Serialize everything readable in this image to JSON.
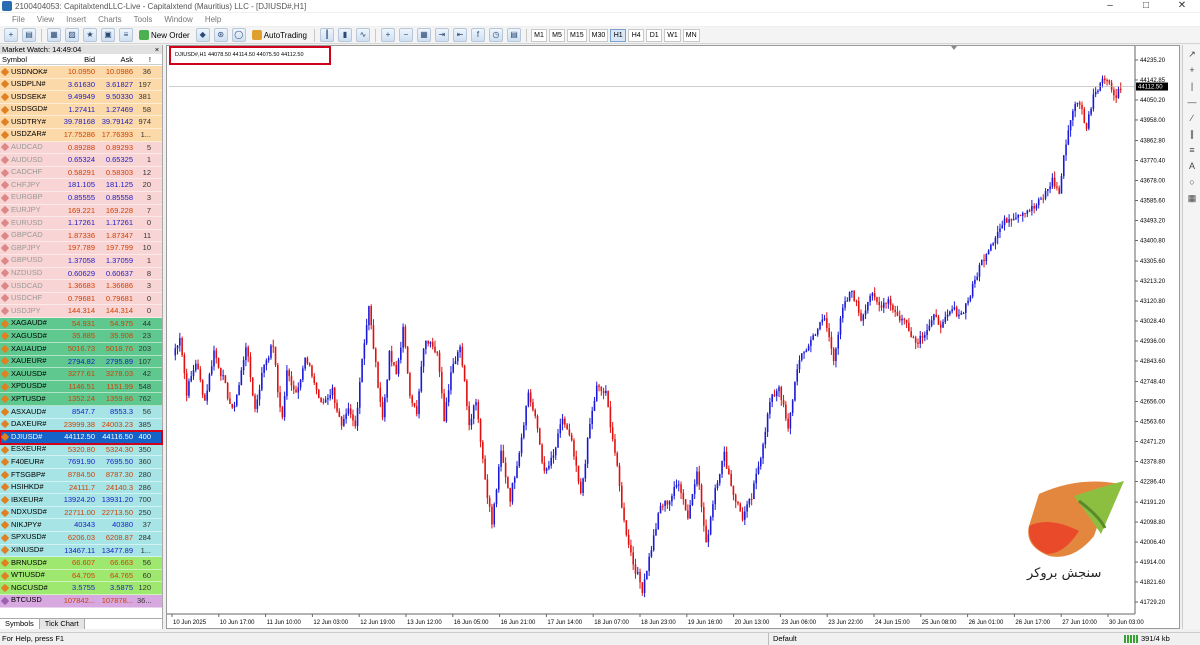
{
  "window": {
    "title": "2100404053: CapitalxtendLLC-Live - Capitalxtend (Mauritius) LLC - [DJIUSD#,H1]"
  },
  "menu": [
    "File",
    "View",
    "Insert",
    "Charts",
    "Tools",
    "Window",
    "Help"
  ],
  "toolbar": {
    "new_order": "New Order",
    "autotrading": "AutoTrading",
    "timeframes": [
      "M1",
      "M5",
      "M15",
      "M30",
      "H1",
      "H4",
      "D1",
      "W1",
      "MN"
    ],
    "active_timeframe": "H1"
  },
  "market_watch": {
    "title": "Market Watch: 14:49:04",
    "columns": {
      "symbol": "Symbol",
      "bid": "Bid",
      "ask": "Ask",
      "spread": "!"
    },
    "selected_symbol": "DJIUSD#",
    "rows": [
      {
        "symbol": "USDNOK#",
        "bid": "10.0950",
        "ask": "10.0986",
        "spread": "36",
        "bg": "#fcd9a8",
        "fg": "#000",
        "num": "#d04000",
        "icon": "#e08020"
      },
      {
        "symbol": "USDPLN#",
        "bid": "3.61630",
        "ask": "3.61827",
        "spread": "197",
        "bg": "#fcd9a8",
        "fg": "#000",
        "num": "#1a1ac8",
        "icon": "#e08020"
      },
      {
        "symbol": "USDSEK#",
        "bid": "9.49949",
        "ask": "9.50330",
        "spread": "381",
        "bg": "#fcd9a8",
        "fg": "#000",
        "num": "#1a1ac8",
        "icon": "#e08020"
      },
      {
        "symbol": "USDSGD#",
        "bid": "1.27411",
        "ask": "1.27469",
        "spread": "58",
        "bg": "#fcd9a8",
        "fg": "#000",
        "num": "#1a1ac8",
        "icon": "#e08020"
      },
      {
        "symbol": "USDTRY#",
        "bid": "39.78168",
        "ask": "39.79142",
        "spread": "974",
        "bg": "#fcd9a8",
        "fg": "#000",
        "num": "#1a1ac8",
        "icon": "#e08020"
      },
      {
        "symbol": "USDZAR#",
        "bid": "17.75286",
        "ask": "17.76393",
        "spread": "1...",
        "bg": "#fcd9a8",
        "fg": "#000",
        "num": "#d04000",
        "icon": "#e08020"
      },
      {
        "symbol": "AUDCAD",
        "bid": "0.89288",
        "ask": "0.89293",
        "spread": "5",
        "bg": "#f9d4d4",
        "fg": "#999",
        "num": "#d04000",
        "icon": "#d88"
      },
      {
        "symbol": "AUDUSD",
        "bid": "0.65324",
        "ask": "0.65325",
        "spread": "1",
        "bg": "#f9d4d4",
        "fg": "#999",
        "num": "#1a1ac8",
        "icon": "#d88"
      },
      {
        "symbol": "CADCHF",
        "bid": "0.58291",
        "ask": "0.58303",
        "spread": "12",
        "bg": "#f9d4d4",
        "fg": "#999",
        "num": "#d04000",
        "icon": "#d88"
      },
      {
        "symbol": "CHFJPY",
        "bid": "181.105",
        "ask": "181.125",
        "spread": "20",
        "bg": "#f9d4d4",
        "fg": "#999",
        "num": "#1a1ac8",
        "icon": "#d88"
      },
      {
        "symbol": "EURGBP",
        "bid": "0.85555",
        "ask": "0.85558",
        "spread": "3",
        "bg": "#f9d4d4",
        "fg": "#999",
        "num": "#1a1ac8",
        "icon": "#d88"
      },
      {
        "symbol": "EURJPY",
        "bid": "169.221",
        "ask": "169.228",
        "spread": "7",
        "bg": "#f9d4d4",
        "fg": "#999",
        "num": "#d04000",
        "icon": "#d88"
      },
      {
        "symbol": "EURUSD",
        "bid": "1.17261",
        "ask": "1.17261",
        "spread": "0",
        "bg": "#f9d4d4",
        "fg": "#999",
        "num": "#1a1ac8",
        "icon": "#d88"
      },
      {
        "symbol": "GBPCAD",
        "bid": "1.87336",
        "ask": "1.87347",
        "spread": "11",
        "bg": "#f9d4d4",
        "fg": "#999",
        "num": "#d04000",
        "icon": "#d88"
      },
      {
        "symbol": "GBPJPY",
        "bid": "197.789",
        "ask": "197.799",
        "spread": "10",
        "bg": "#f9d4d4",
        "fg": "#999",
        "num": "#d04000",
        "icon": "#d88"
      },
      {
        "symbol": "GBPUSD",
        "bid": "1.37058",
        "ask": "1.37059",
        "spread": "1",
        "bg": "#f9d4d4",
        "fg": "#999",
        "num": "#1a1ac8",
        "icon": "#d88"
      },
      {
        "symbol": "NZDUSD",
        "bid": "0.60629",
        "ask": "0.60637",
        "spread": "8",
        "bg": "#f9d4d4",
        "fg": "#999",
        "num": "#1a1ac8",
        "icon": "#d88"
      },
      {
        "symbol": "USDCAD",
        "bid": "1.36683",
        "ask": "1.36686",
        "spread": "3",
        "bg": "#f9d4d4",
        "fg": "#999",
        "num": "#d04000",
        "icon": "#d88"
      },
      {
        "symbol": "USDCHF",
        "bid": "0.79681",
        "ask": "0.79681",
        "spread": "0",
        "bg": "#f9d4d4",
        "fg": "#999",
        "num": "#d04000",
        "icon": "#d88"
      },
      {
        "symbol": "USDJPY",
        "bid": "144.314",
        "ask": "144.314",
        "spread": "0",
        "bg": "#f9d4d4",
        "fg": "#999",
        "num": "#d04000",
        "icon": "#d88"
      },
      {
        "symbol": "XAGAUD#",
        "bid": "54.931",
        "ask": "54.975",
        "spread": "44",
        "bg": "#5fc88f",
        "fg": "#000",
        "num": "#d04000",
        "icon": "#e08020"
      },
      {
        "symbol": "XAGUSD#",
        "bid": "35.885",
        "ask": "35.908",
        "spread": "23",
        "bg": "#5fc88f",
        "fg": "#000",
        "num": "#d04000",
        "icon": "#e08020"
      },
      {
        "symbol": "XAUAUD#",
        "bid": "5016.73",
        "ask": "5018.76",
        "spread": "203",
        "bg": "#5fc88f",
        "fg": "#000",
        "num": "#d04000",
        "icon": "#e08020"
      },
      {
        "symbol": "XAUEUR#",
        "bid": "2794.82",
        "ask": "2795.89",
        "spread": "107",
        "bg": "#5fc88f",
        "fg": "#000",
        "num": "#1a1ac8",
        "icon": "#e08020"
      },
      {
        "symbol": "XAUUSD#",
        "bid": "3277.61",
        "ask": "3278.03",
        "spread": "42",
        "bg": "#5fc88f",
        "fg": "#000",
        "num": "#d04000",
        "icon": "#e08020"
      },
      {
        "symbol": "XPDUSD#",
        "bid": "1146.51",
        "ask": "1151.99",
        "spread": "548",
        "bg": "#5fc88f",
        "fg": "#000",
        "num": "#d04000",
        "icon": "#e08020"
      },
      {
        "symbol": "XPTUSD#",
        "bid": "1352.24",
        "ask": "1359.86",
        "spread": "762",
        "bg": "#5fc88f",
        "fg": "#000",
        "num": "#d04000",
        "icon": "#e08020"
      },
      {
        "symbol": "ASXAUD#",
        "bid": "8547.7",
        "ask": "8553.3",
        "spread": "56",
        "bg": "#a6e4e6",
        "fg": "#000",
        "num": "#1a1ac8",
        "icon": "#e08020"
      },
      {
        "symbol": "DAXEUR#",
        "bid": "23999.38",
        "ask": "24003.23",
        "spread": "385",
        "bg": "#a6e4e6",
        "fg": "#000",
        "num": "#d04000",
        "icon": "#e08020"
      },
      {
        "symbol": "DJIUSD#",
        "bid": "44112.50",
        "ask": "44116.50",
        "spread": "400",
        "bg": "#1463c8",
        "fg": "#fff",
        "num": "#fff",
        "icon": "#e08020"
      },
      {
        "symbol": "ESXEUR#",
        "bid": "5320.80",
        "ask": "5324.30",
        "spread": "350",
        "bg": "#a6e4e6",
        "fg": "#000",
        "num": "#d04000",
        "icon": "#e08020"
      },
      {
        "symbol": "F40EUR#",
        "bid": "7691.90",
        "ask": "7695.50",
        "spread": "360",
        "bg": "#a6e4e6",
        "fg": "#000",
        "num": "#1a1ac8",
        "icon": "#e08020"
      },
      {
        "symbol": "FTSGBP#",
        "bid": "8784.50",
        "ask": "8787.30",
        "spread": "280",
        "bg": "#a6e4e6",
        "fg": "#000",
        "num": "#d04000",
        "icon": "#e08020"
      },
      {
        "symbol": "HSIHKD#",
        "bid": "24111.7",
        "ask": "24140.3",
        "spread": "286",
        "bg": "#a6e4e6",
        "fg": "#000",
        "num": "#d04000",
        "icon": "#e08020"
      },
      {
        "symbol": "IBXEUR#",
        "bid": "13924.20",
        "ask": "13931.20",
        "spread": "700",
        "bg": "#a6e4e6",
        "fg": "#000",
        "num": "#1a1ac8",
        "icon": "#e08020"
      },
      {
        "symbol": "NDXUSD#",
        "bid": "22711.00",
        "ask": "22713.50",
        "spread": "250",
        "bg": "#a6e4e6",
        "fg": "#000",
        "num": "#d04000",
        "icon": "#e08020"
      },
      {
        "symbol": "NIKJPY#",
        "bid": "40343",
        "ask": "40380",
        "spread": "37",
        "bg": "#a6e4e6",
        "fg": "#000",
        "num": "#1a1ac8",
        "icon": "#e08020"
      },
      {
        "symbol": "SPXUSD#",
        "bid": "6206.03",
        "ask": "6208.87",
        "spread": "284",
        "bg": "#a6e4e6",
        "fg": "#000",
        "num": "#d04000",
        "icon": "#e08020"
      },
      {
        "symbol": "XINUSD#",
        "bid": "13467.11",
        "ask": "13477.89",
        "spread": "1...",
        "bg": "#a6e4e6",
        "fg": "#000",
        "num": "#1a1ac8",
        "icon": "#e08020"
      },
      {
        "symbol": "BRNUSD#",
        "bid": "66.607",
        "ask": "66.663",
        "spread": "56",
        "bg": "#9fe870",
        "fg": "#000",
        "num": "#d04000",
        "icon": "#e08020"
      },
      {
        "symbol": "WTIUSD#",
        "bid": "64.705",
        "ask": "64.765",
        "spread": "60",
        "bg": "#9fe870",
        "fg": "#000",
        "num": "#d04000",
        "icon": "#e08020"
      },
      {
        "symbol": "NGCUSD#",
        "bid": "3.5755",
        "ask": "3.5875",
        "spread": "120",
        "bg": "#9fe870",
        "fg": "#000",
        "num": "#1a1ac8",
        "icon": "#e08020"
      },
      {
        "symbol": "BTCUSD",
        "bid": "107842...",
        "ask": "107878...",
        "spread": "36...",
        "bg": "#d8a8e0",
        "fg": "#000",
        "num": "#d04000",
        "icon": "#a060b0"
      }
    ],
    "tabs": [
      "Symbols",
      "Tick Chart"
    ]
  },
  "chart": {
    "info": "DJIUSD#,H1  44078.50 44114.50 44075.50 44112.50",
    "current_price": "44112.50",
    "price_labels": [
      "44235.20",
      "44142.85",
      "44050.20",
      "43958.00",
      "43862.80",
      "43770.40",
      "43678.00",
      "43585.60",
      "43493.20",
      "43400.80",
      "43305.60",
      "43213.20",
      "43120.80",
      "43028.40",
      "42936.00",
      "42843.60",
      "42748.40",
      "42656.00",
      "42563.60",
      "42471.20",
      "42378.80",
      "42286.40",
      "42191.20",
      "42098.80",
      "42006.40",
      "41914.00",
      "41821.60",
      "41729.20"
    ],
    "time_labels": [
      "10 Jun 2025",
      "10 Jun 17:00",
      "11 Jun 10:00",
      "12 Jun 03:00",
      "12 Jun 19:00",
      "13 Jun 12:00",
      "16 Jun 05:00",
      "16 Jun 21:00",
      "17 Jun 14:00",
      "18 Jun 07:00",
      "18 Jun 23:00",
      "19 Jun 16:00",
      "20 Jun 13:00",
      "23 Jun 06:00",
      "23 Jun 22:00",
      "24 Jun 15:00",
      "25 Jun 08:00",
      "26 Jun 01:00",
      "26 Jun 17:00",
      "27 Jun 10:00",
      "30 Jun 03:00"
    ],
    "up_color": "#1a1ad6",
    "down_color": "#e01010",
    "price_anchors": [
      [
        0,
        42870
      ],
      [
        3,
        42960
      ],
      [
        6,
        42700
      ],
      [
        10,
        42840
      ],
      [
        14,
        42660
      ],
      [
        18,
        42890
      ],
      [
        22,
        42760
      ],
      [
        26,
        42610
      ],
      [
        29,
        42730
      ],
      [
        32,
        42920
      ],
      [
        36,
        42620
      ],
      [
        40,
        42830
      ],
      [
        44,
        42920
      ],
      [
        46,
        42700
      ],
      [
        48,
        42580
      ],
      [
        50,
        42790
      ],
      [
        54,
        42700
      ],
      [
        58,
        42850
      ],
      [
        61,
        42780
      ],
      [
        65,
        42640
      ],
      [
        70,
        42710
      ],
      [
        74,
        42530
      ],
      [
        77,
        42610
      ],
      [
        80,
        42540
      ],
      [
        83,
        42860
      ],
      [
        86,
        43090
      ],
      [
        89,
        42820
      ],
      [
        92,
        42580
      ],
      [
        95,
        42870
      ],
      [
        98,
        42780
      ],
      [
        101,
        42990
      ],
      [
        104,
        42700
      ],
      [
        107,
        42590
      ],
      [
        110,
        42910
      ],
      [
        113,
        42950
      ],
      [
        116,
        42880
      ],
      [
        119,
        42580
      ],
      [
        122,
        42800
      ],
      [
        126,
        42920
      ],
      [
        130,
        42560
      ],
      [
        133,
        42670
      ],
      [
        137,
        42300
      ],
      [
        140,
        42090
      ],
      [
        144,
        42420
      ],
      [
        148,
        42210
      ],
      [
        152,
        42430
      ],
      [
        156,
        42700
      ],
      [
        160,
        42530
      ],
      [
        163,
        42320
      ],
      [
        167,
        42400
      ],
      [
        171,
        42580
      ],
      [
        175,
        42460
      ],
      [
        179,
        42220
      ],
      [
        183,
        42550
      ],
      [
        186,
        42720
      ],
      [
        190,
        42690
      ],
      [
        194,
        42420
      ],
      [
        198,
        42100
      ],
      [
        202,
        41910
      ],
      [
        206,
        41790
      ],
      [
        210,
        41980
      ],
      [
        214,
        42170
      ],
      [
        218,
        42200
      ],
      [
        222,
        42290
      ],
      [
        226,
        42120
      ],
      [
        230,
        42350
      ],
      [
        234,
        41990
      ],
      [
        238,
        42260
      ],
      [
        242,
        42410
      ],
      [
        246,
        42230
      ],
      [
        250,
        42120
      ],
      [
        254,
        42210
      ],
      [
        258,
        42410
      ],
      [
        262,
        42650
      ],
      [
        266,
        42730
      ],
      [
        270,
        42520
      ],
      [
        274,
        42820
      ],
      [
        278,
        42900
      ],
      [
        282,
        42980
      ],
      [
        286,
        43040
      ],
      [
        290,
        42860
      ],
      [
        294,
        43080
      ],
      [
        298,
        43170
      ],
      [
        302,
        43040
      ],
      [
        306,
        43150
      ],
      [
        310,
        43100
      ],
      [
        314,
        43130
      ],
      [
        318,
        43050
      ],
      [
        322,
        43020
      ],
      [
        326,
        42930
      ],
      [
        330,
        42980
      ],
      [
        334,
        43040
      ],
      [
        338,
        43010
      ],
      [
        342,
        43080
      ],
      [
        346,
        43060
      ],
      [
        350,
        43150
      ],
      [
        354,
        43280
      ],
      [
        358,
        43370
      ],
      [
        362,
        43440
      ],
      [
        366,
        43500
      ],
      [
        370,
        43520
      ],
      [
        374,
        43540
      ],
      [
        378,
        43550
      ],
      [
        382,
        43600
      ],
      [
        386,
        43680
      ],
      [
        389,
        43620
      ],
      [
        392,
        43860
      ],
      [
        395,
        44010
      ],
      [
        398,
        44040
      ],
      [
        401,
        43920
      ],
      [
        404,
        44080
      ],
      [
        407,
        44130
      ],
      [
        410,
        44160
      ],
      [
        413,
        44070
      ],
      [
        416,
        44100
      ]
    ]
  }
}
